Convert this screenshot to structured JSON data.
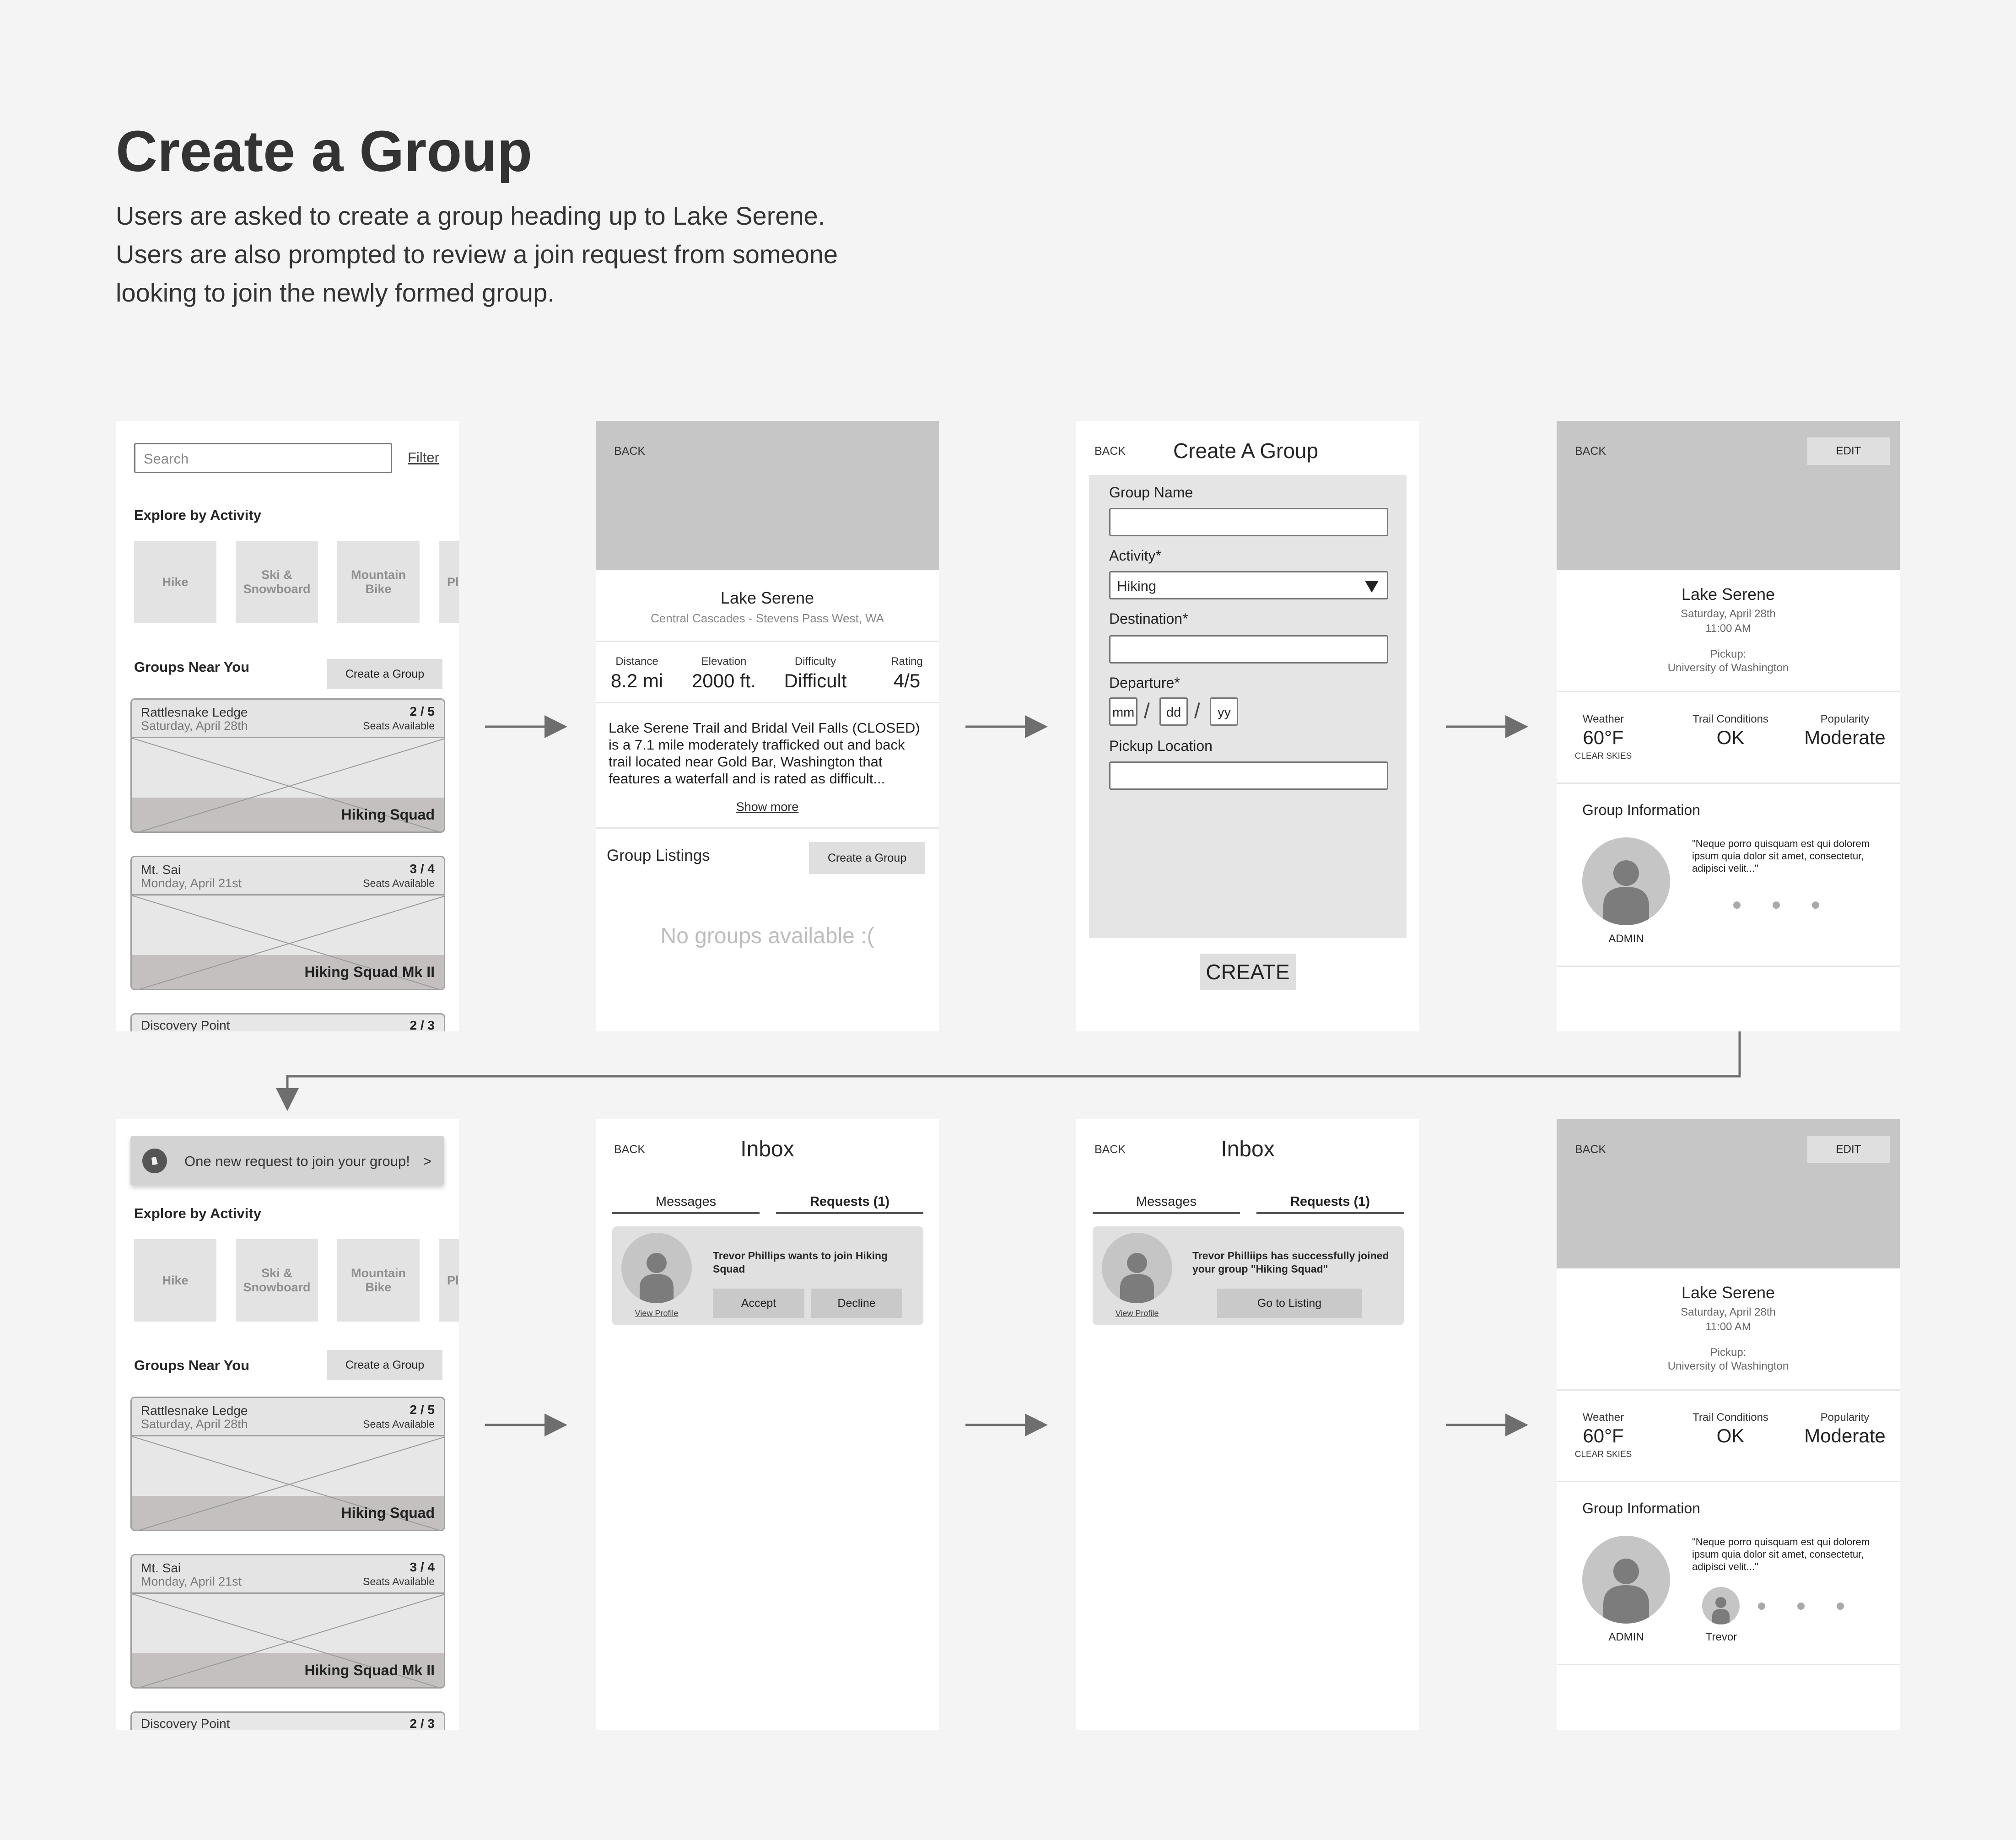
{
  "header": {
    "title": "Create a Group",
    "description": "Users are asked to create a group heading up to Lake Serene. Users are also prompted to review a join request from someone looking to join the newly formed group."
  },
  "explore": {
    "search_placeholder": "Search",
    "filter": "Filter",
    "section_title": "Explore by Activity",
    "tiles": [
      "Hike",
      "Ski & Snowboard",
      "Mountain Bike",
      "Pl"
    ],
    "groups_title": "Groups Near You",
    "create_button": "Create a Group",
    "cards": [
      {
        "name": "Rattlesnake Ledge",
        "date": "Saturday, April 28th",
        "seats": "2 / 5",
        "seats_label": "Seats Available",
        "group": "Hiking Squad"
      },
      {
        "name": "Mt. Sai",
        "date": "Monday, April 21st",
        "seats": "3 / 4",
        "seats_label": "Seats Available",
        "group": "Hiking Squad Mk II"
      },
      {
        "name": "Discovery Point",
        "seats": "2 / 3"
      }
    ],
    "notification": "One new request to join your group!",
    "notification_chevron": ">"
  },
  "trail": {
    "back": "BACK",
    "name": "Lake Serene",
    "region": "Central Cascades - Stevens Pass West, WA",
    "stats": [
      {
        "label": "Distance",
        "value": "8.2 mi"
      },
      {
        "label": "Elevation",
        "value": "2000 ft."
      },
      {
        "label": "Difficulty",
        "value": "Difficult"
      },
      {
        "label": "Rating",
        "value": "4/5"
      }
    ],
    "description": "Lake Serene Trail and Bridal Veil Falls (CLOSED) is a 7.1 mile moderately trafficked out and back trail located near Gold Bar, Washington that features a waterfall and is rated as difficult...",
    "show_more": "Show more",
    "listings_title": "Group Listings",
    "create_button": "Create a Group",
    "empty": "No groups available :("
  },
  "form": {
    "back": "BACK",
    "title": "Create A Group",
    "group_name": "Group Name",
    "activity": "Activity*",
    "activity_value": "Hiking",
    "destination": "Destination*",
    "departure": "Departure*",
    "mm": "mm",
    "dd": "dd",
    "yy": "yy",
    "slash": "/",
    "pickup": "Pickup Location",
    "create": "CREATE"
  },
  "detail": {
    "back": "BACK",
    "edit": "EDIT",
    "name": "Lake Serene",
    "date": "Saturday, April 28th",
    "time": "11:00 AM",
    "pickup_label": "Pickup:",
    "pickup": "University of Washington",
    "weather_label": "Weather",
    "weather": "60°F",
    "weather_sub": "CLEAR SKIES",
    "trail_label": "Trail Conditions",
    "trail": "OK",
    "popularity_label": "Popularity",
    "popularity": "Moderate",
    "group_info": "Group Information",
    "quote": "\"Neque porro quisquam est qui dolorem ipsum quia dolor sit amet, consectetur, adipisci velit...\"",
    "admin": "ADMIN",
    "member": "Trevor"
  },
  "inbox": {
    "back": "BACK",
    "title": "Inbox",
    "tab_messages": "Messages",
    "tab_requests": "Requests (1)",
    "request_text": "Trevor Phillips wants to join Hiking Squad",
    "view_profile": "View Profile",
    "accept": "Accept",
    "decline": "Decline",
    "joined_text": "Trevor Philliips has successfully joined your group \"Hiking Squad\"",
    "go_listing": "Go to Listing"
  }
}
